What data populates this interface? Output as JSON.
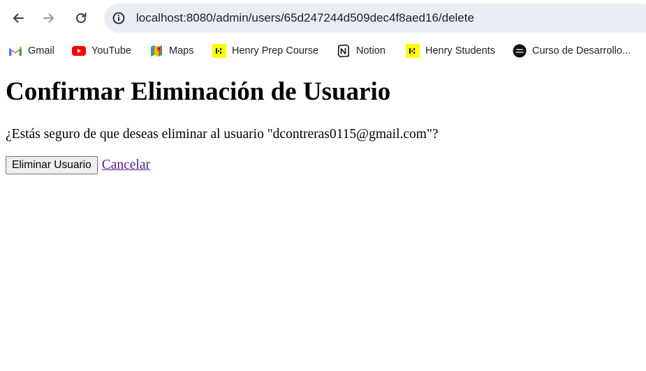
{
  "browser": {
    "url": "localhost:8080/admin/users/65d247244d509dec4f8aed16/delete",
    "nav": {
      "back_icon": "arrow-left-icon",
      "forward_icon": "arrow-right-icon",
      "reload_icon": "reload-icon",
      "site_info_icon": "info-circle-icon"
    },
    "bookmarks": [
      {
        "label": "Gmail",
        "icon": "gmail-icon"
      },
      {
        "label": "YouTube",
        "icon": "youtube-icon"
      },
      {
        "label": "Maps",
        "icon": "maps-icon"
      },
      {
        "label": "Henry Prep Course",
        "icon": "henry-icon"
      },
      {
        "label": "Notion",
        "icon": "notion-icon"
      },
      {
        "label": "Henry Students",
        "icon": "henry-icon"
      },
      {
        "label": "Curso de Desarrollo...",
        "icon": "coder-icon"
      }
    ]
  },
  "page": {
    "heading": "Confirmar Eliminación de Usuario",
    "question": "¿Estás seguro de que deseas eliminar al usuario \"dcontreras0115@gmail.com\"?",
    "delete_button": "Eliminar Usuario",
    "cancel_link": "Cancelar"
  },
  "colors": {
    "omnibox_bg": "#e9eef6",
    "visited_link": "#551a8b",
    "henry_yellow": "#ffff01",
    "youtube_red": "#ff0000"
  }
}
